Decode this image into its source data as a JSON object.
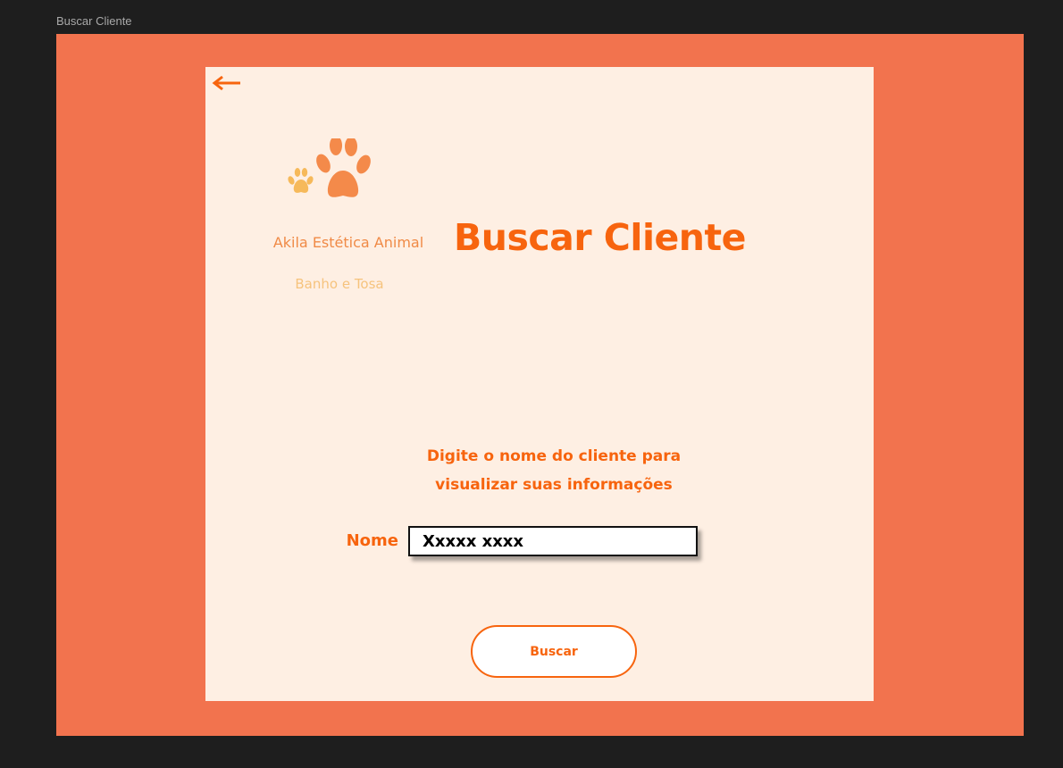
{
  "frame": {
    "title": "Buscar Cliente"
  },
  "nav": {
    "back_icon": "arrow-left-icon"
  },
  "brand": {
    "logo_icon": "paw-prints-icon",
    "name": "Akila Estética  Animal",
    "tagline": "Banho e Tosa"
  },
  "page": {
    "title": "Buscar Cliente"
  },
  "search": {
    "instruction_line1": "Digite o nome do cliente para",
    "instruction_line2": "visualizar suas informações",
    "name_label": "Nome",
    "name_value": "Xxxxx xxxx",
    "button_label": "Buscar"
  },
  "colors": {
    "background": "#1e1e1e",
    "frame": "#f2734e",
    "card": "#feefe3",
    "accent": "#f7640e",
    "brand_text": "#f08a46",
    "tagline_text": "#f6c37d",
    "paw_large": "#f48a4a",
    "paw_small": "#f6b95a"
  }
}
